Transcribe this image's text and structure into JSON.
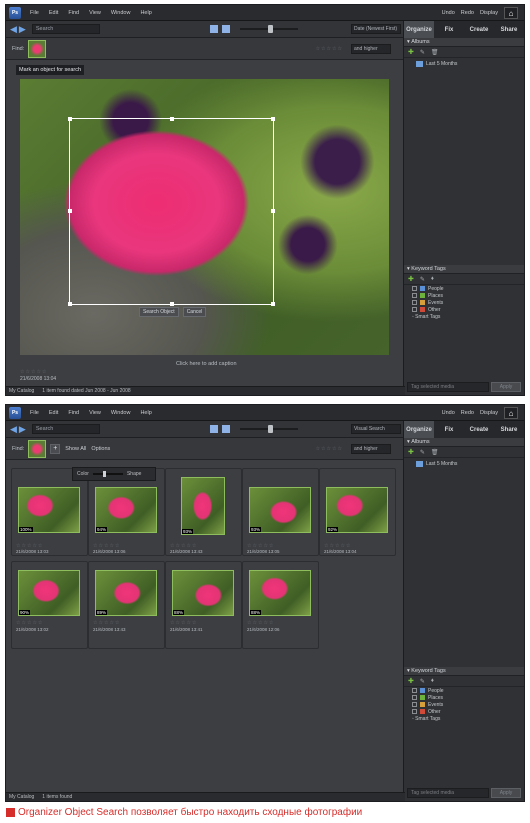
{
  "menu": {
    "items": [
      "File",
      "Edit",
      "Find",
      "View",
      "Window",
      "Help"
    ],
    "undo": "Undo",
    "redo": "Redo",
    "display": "Display"
  },
  "toolbar": {
    "search_placeholder": "Search",
    "sort": "Date (Newest First)"
  },
  "screen1": {
    "find_label": "Find:",
    "rating_filter": "and higher",
    "mark_tooltip": "Mark an object for search",
    "object_buttons": [
      "Search Object",
      "Cancel"
    ],
    "caption": "Click here to add caption",
    "photo_date": "21/6/2008 13:04",
    "status": [
      "My Catalog",
      "1 item found dated Jun 2008 - Jun 2008"
    ]
  },
  "screen2": {
    "find_label": "Find:",
    "show_all": "Show All",
    "options": "Options",
    "popup_labels": [
      "Color",
      "Shape"
    ],
    "sort": "Visual Search",
    "rating_filter": "and higher",
    "photos": [
      {
        "pct": "100%",
        "date": "21/6/2008 13:03"
      },
      {
        "pct": "94%",
        "date": "21/6/2008 13:06"
      },
      {
        "pct": "93%",
        "date": "21/6/2008 13:43"
      },
      {
        "pct": "93%",
        "date": "21/6/2008 13:05"
      },
      {
        "pct": "92%",
        "date": "21/6/2008 13:04"
      },
      {
        "pct": "90%",
        "date": "21/6/2008 13:02"
      },
      {
        "pct": "89%",
        "date": "21/6/2008 13:43"
      },
      {
        "pct": "88%",
        "date": "21/6/2008 13:41"
      },
      {
        "pct": "88%",
        "date": "21/6/2008 12:06"
      }
    ],
    "status": [
      "My Catalog",
      "1 items found"
    ]
  },
  "panel": {
    "tabs": [
      "Organize",
      "Fix",
      "Create",
      "Share"
    ],
    "albums_header": "Albums",
    "album_item": "Last 5 Months",
    "keywords_header": "Keyword Tags",
    "keywords": [
      {
        "label": "People",
        "color": "#5b8fd6"
      },
      {
        "label": "Places",
        "color": "#6cb23c"
      },
      {
        "label": "Events",
        "color": "#d8a03a"
      },
      {
        "label": "Other",
        "color": "#d04a3a"
      }
    ],
    "smart_tags": "Smart Tags",
    "tag_field": "Tag selected media",
    "apply": "Apply"
  },
  "figure_caption": "Organizer Object Search позволяет быстро находить сходные фотографии"
}
